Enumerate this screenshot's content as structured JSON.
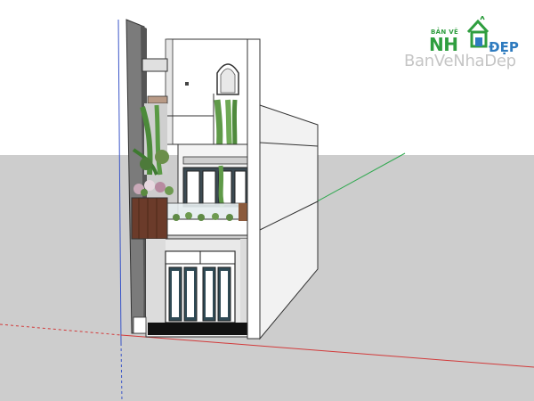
{
  "app": {
    "viewport_label": ""
  },
  "logo": {
    "top_text": "BẢN VẼ",
    "main_text": "NH",
    "side_text": "ĐẸP",
    "colors": {
      "green": "#2f9e3f",
      "blue": "#2e7bbf"
    }
  },
  "watermark": {
    "text": "BanVeNhaDep"
  },
  "scene": {
    "description_icon": "house-3d-model",
    "axis_colors": {
      "red": "#d23a3a",
      "green": "#2fa84f",
      "blue": "#3a55c8"
    }
  }
}
